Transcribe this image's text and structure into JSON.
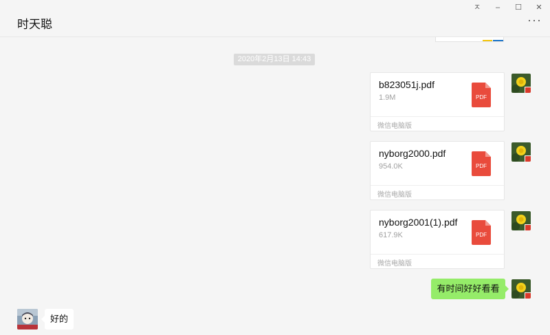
{
  "window": {
    "title": "时天聪",
    "pin_glyph": "ㅈ",
    "minimize_glyph": "–",
    "maximize_glyph": "☐",
    "close_glyph": "✕",
    "more_glyph": "···"
  },
  "timestamp": "2020年2月13日 14:43",
  "files": [
    {
      "name": "b823051j.pdf",
      "size": "1.9M",
      "source": "微信电脑版",
      "icon_label": "PDF"
    },
    {
      "name": "nyborg2000.pdf",
      "size": "954.0K",
      "source": "微信电脑版",
      "icon_label": "PDF"
    },
    {
      "name": "nyborg2001(1).pdf",
      "size": "617.9K",
      "source": "微信电脑版",
      "icon_label": "PDF"
    }
  ],
  "messages": {
    "sent_text": "有时间好好看看",
    "received_text": "好的"
  },
  "colors": {
    "background": "#f5f5f5",
    "sent_bubble": "#95ec69",
    "pdf_red": "#e94b3c"
  },
  "icons": {
    "my_avatar": "dandelion-flower-avatar",
    "contact_avatar": "cartoon-character-avatar",
    "file": "pdf-file-icon"
  }
}
